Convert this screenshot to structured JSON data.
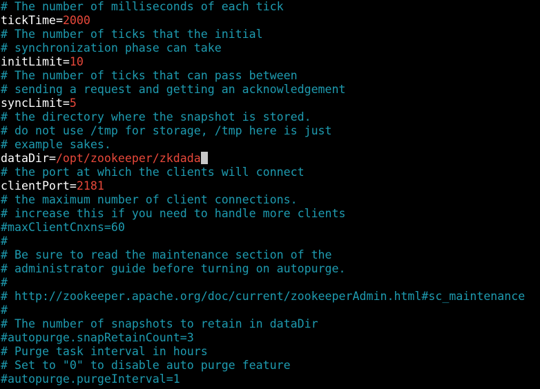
{
  "terminal": {
    "lines": [
      {
        "type": "comment",
        "text": "# The number of milliseconds of each tick"
      },
      {
        "type": "setting",
        "key": "tickTime",
        "value": "2000"
      },
      {
        "type": "comment",
        "text": "# The number of ticks that the initial"
      },
      {
        "type": "comment",
        "text": "# synchronization phase can take"
      },
      {
        "type": "setting",
        "key": "initLimit",
        "value": "10"
      },
      {
        "type": "comment",
        "text": "# The number of ticks that can pass between"
      },
      {
        "type": "comment",
        "text": "# sending a request and getting an acknowledgement"
      },
      {
        "type": "setting",
        "key": "syncLimit",
        "value": "5"
      },
      {
        "type": "comment",
        "text": "# the directory where the snapshot is stored."
      },
      {
        "type": "comment",
        "text": "# do not use /tmp for storage, /tmp here is just"
      },
      {
        "type": "comment",
        "text": "# example sakes."
      },
      {
        "type": "setting",
        "key": "dataDir",
        "value": "/opt/zookeeper/zkdada",
        "cursor": true
      },
      {
        "type": "comment",
        "text": "# the port at which the clients will connect"
      },
      {
        "type": "setting",
        "key": "clientPort",
        "value": "2181"
      },
      {
        "type": "comment",
        "text": "# the maximum number of client connections."
      },
      {
        "type": "comment",
        "text": "# increase this if you need to handle more clients"
      },
      {
        "type": "comment",
        "text": "#maxClientCnxns=60"
      },
      {
        "type": "comment",
        "text": "#"
      },
      {
        "type": "comment",
        "text": "# Be sure to read the maintenance section of the"
      },
      {
        "type": "comment",
        "text": "# administrator guide before turning on autopurge."
      },
      {
        "type": "comment",
        "text": "#"
      },
      {
        "type": "comment",
        "text": "# http://zookeeper.apache.org/doc/current/zookeeperAdmin.html#sc_maintenance"
      },
      {
        "type": "comment",
        "text": "#"
      },
      {
        "type": "comment",
        "text": "# The number of snapshots to retain in dataDir"
      },
      {
        "type": "comment",
        "text": "#autopurge.snapRetainCount=3"
      },
      {
        "type": "comment",
        "text": "# Purge task interval in hours"
      },
      {
        "type": "comment",
        "text": "# Set to \"0\" to disable auto purge feature"
      },
      {
        "type": "comment",
        "text": "#autopurge.purgeInterval=1"
      }
    ]
  },
  "colors": {
    "background": "#000000",
    "comment": "#1e9bb0",
    "key": "#ffffff",
    "value": "#e8483a",
    "cursor": "#c8c8c8"
  }
}
